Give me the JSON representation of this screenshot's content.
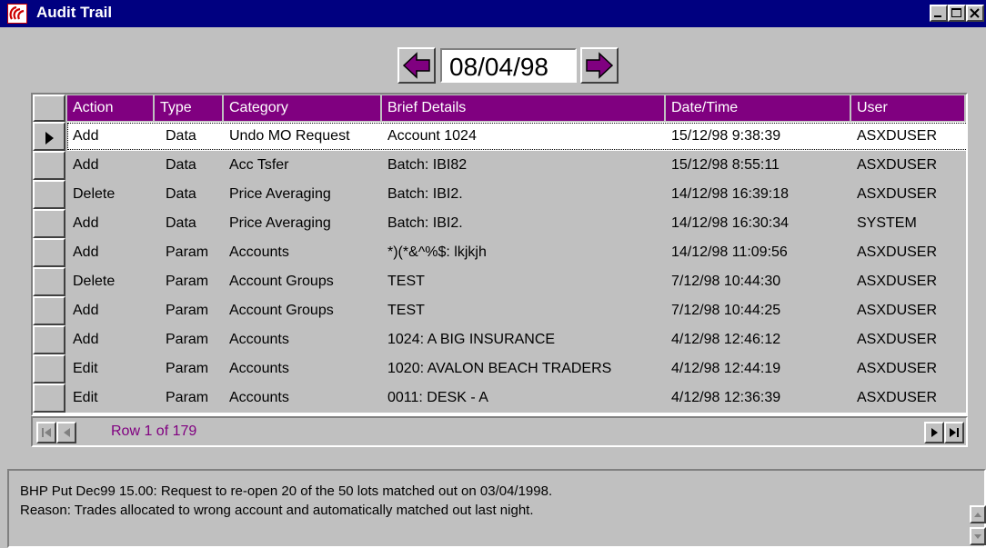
{
  "window": {
    "title": "Audit Trail"
  },
  "date_nav": {
    "date": "08/04/98"
  },
  "columns": [
    "Action",
    "Type",
    "Category",
    "Brief Details",
    "Date/Time",
    "User"
  ],
  "rows": [
    {
      "action": "Add",
      "type": "Data",
      "category": "Undo MO Request",
      "details": "Account 1024",
      "datetime": "15/12/98 9:38:39",
      "user": "ASXDUSER"
    },
    {
      "action": "Add",
      "type": "Data",
      "category": "Acc Tsfer",
      "details": "Batch: IBI82",
      "datetime": "15/12/98 8:55:11",
      "user": "ASXDUSER"
    },
    {
      "action": "Delete",
      "type": "Data",
      "category": "Price Averaging",
      "details": "Batch: IBI2.",
      "datetime": "14/12/98 16:39:18",
      "user": "ASXDUSER"
    },
    {
      "action": "Add",
      "type": "Data",
      "category": "Price Averaging",
      "details": "Batch: IBI2.",
      "datetime": "14/12/98 16:30:34",
      "user": "SYSTEM"
    },
    {
      "action": "Add",
      "type": "Param",
      "category": "Accounts",
      "details": "*)(*&^%$: lkjkjh",
      "datetime": "14/12/98 11:09:56",
      "user": "ASXDUSER"
    },
    {
      "action": "Delete",
      "type": "Param",
      "category": "Account Groups",
      "details": "TEST",
      "datetime": "7/12/98 10:44:30",
      "user": "ASXDUSER"
    },
    {
      "action": "Add",
      "type": "Param",
      "category": "Account Groups",
      "details": "TEST",
      "datetime": "7/12/98 10:44:25",
      "user": "ASXDUSER"
    },
    {
      "action": "Add",
      "type": "Param",
      "category": "Accounts",
      "details": "1024: A BIG INSURANCE",
      "datetime": "4/12/98 12:46:12",
      "user": "ASXDUSER"
    },
    {
      "action": "Edit",
      "type": "Param",
      "category": "Accounts",
      "details": "1020: AVALON BEACH TRADERS",
      "datetime": "4/12/98 12:44:19",
      "user": "ASXDUSER"
    },
    {
      "action": "Edit",
      "type": "Param",
      "category": "Accounts",
      "details": "0011: DESK - A",
      "datetime": "4/12/98 12:36:39",
      "user": "ASXDUSER"
    }
  ],
  "footer": {
    "row_indicator": "Row 1 of 179"
  },
  "details": {
    "line1": "BHP Put Dec99 15.00: Request to re-open 20 of the 50 lots matched out on 03/04/1998.",
    "line2": "Reason: Trades allocated to wrong account and automatically matched out last night."
  },
  "colors": {
    "title_bar": "#000080",
    "header": "#800080",
    "face": "#c0c0c0",
    "nav_arrow": "#800080"
  },
  "icons": [
    "app-icon",
    "minimize-icon",
    "maximize-icon",
    "close-icon",
    "left-arrow-icon",
    "right-arrow-icon",
    "first-record-icon",
    "prev-record-icon",
    "next-record-icon",
    "last-record-icon",
    "scroll-up-icon",
    "scroll-down-icon"
  ]
}
